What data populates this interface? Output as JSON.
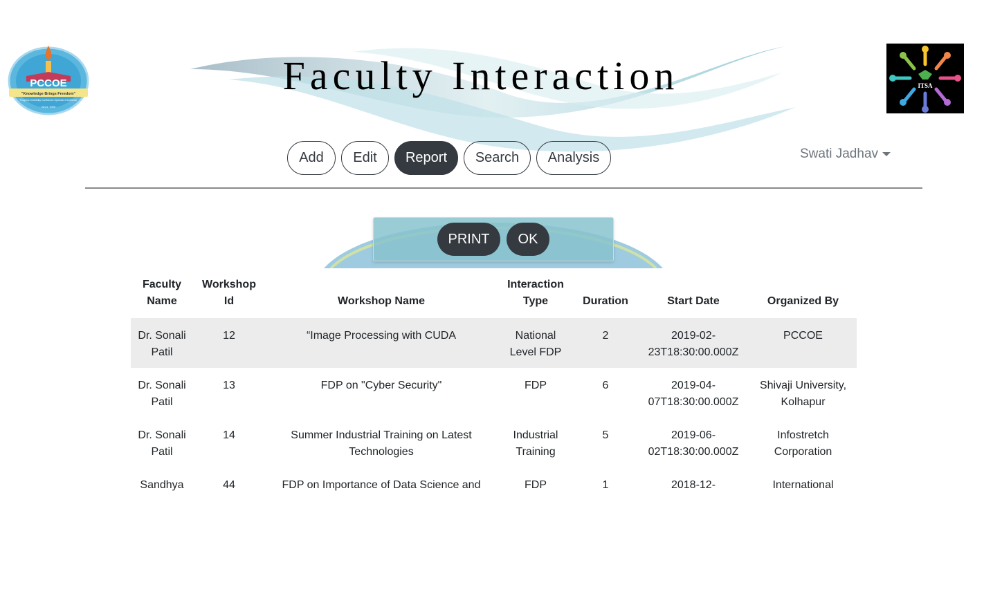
{
  "header": {
    "title": "Faculty Interaction",
    "left_logo": {
      "name": "PCCOE",
      "tagline": "\"Knowledge Brings Freedom\"",
      "motto": "Progress Credibility Confidence Optimism Excellence",
      "since": "Since 1999"
    },
    "right_logo": {
      "name": "ITSA"
    }
  },
  "nav": {
    "items": [
      {
        "label": "Add"
      },
      {
        "label": "Edit"
      },
      {
        "label": "Report",
        "active": true
      },
      {
        "label": "Search"
      },
      {
        "label": "Analysis"
      }
    ]
  },
  "user_menu": {
    "name": "Swati Jadhav"
  },
  "actions": {
    "print_label": "PRINT",
    "ok_label": "OK"
  },
  "table": {
    "headers": [
      "Faculty Name",
      "Workshop Id",
      "Workshop Name",
      "Interaction Type",
      "Duration",
      "Start Date",
      "Organized By"
    ],
    "rows": [
      [
        "Dr. Sonali Patil",
        "12",
        "“Image Processing with CUDA",
        "National Level FDP",
        "2",
        "2019-02-23T18:30:00.000Z",
        "PCCOE"
      ],
      [
        "Dr. Sonali Patil",
        "13",
        "FDP on \"Cyber Security\"",
        "FDP",
        "6",
        "2019-04-07T18:30:00.000Z",
        "Shivaji University, Kolhapur"
      ],
      [
        "Dr. Sonali Patil",
        "14",
        "Summer Industrial Training on Latest Technologies",
        "Industrial Training",
        "5",
        "2019-06-02T18:30:00.000Z",
        "Infostretch Corporation"
      ],
      [
        "Sandhya",
        "44",
        "FDP on Importance of Data Science and",
        "FDP",
        "1",
        "2018-12-",
        "International"
      ]
    ]
  },
  "colors": {
    "dark": "#343a40",
    "muted": "#6c757d",
    "stripe": "#ececec",
    "teal": "#87c3cd"
  }
}
